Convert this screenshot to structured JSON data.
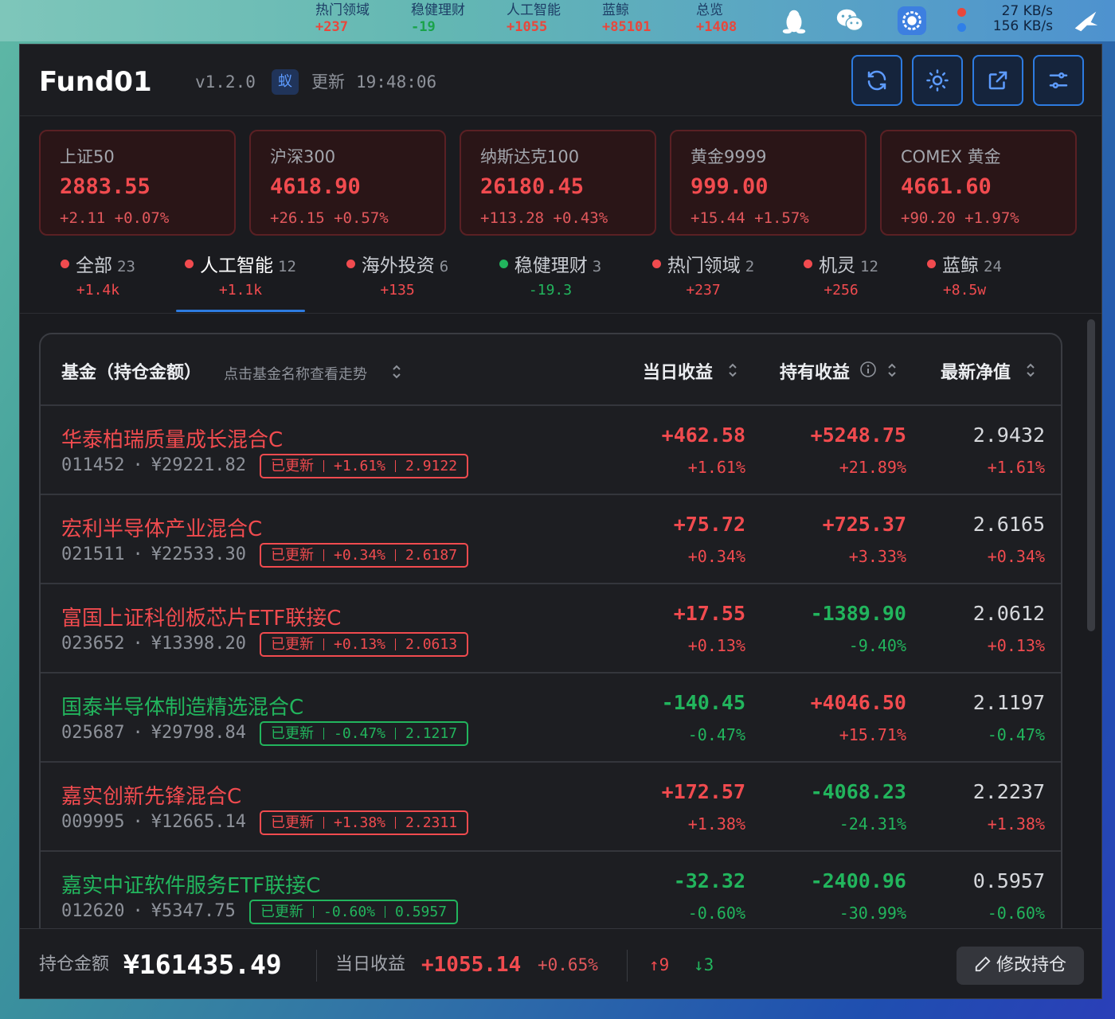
{
  "menubar": {
    "tickers": [
      {
        "name": "热门领域",
        "value": "+237",
        "dir": "up"
      },
      {
        "name": "稳健理财",
        "value": "-19",
        "dir": "down"
      },
      {
        "name": "人工智能",
        "value": "+1055",
        "dir": "up"
      },
      {
        "name": "蓝鲸",
        "value": "+85101",
        "dir": "up"
      },
      {
        "name": "总览",
        "value": "+1408",
        "dir": "up"
      }
    ],
    "net_up": "27 KB/s",
    "net_down": "156 KB/s"
  },
  "header": {
    "app_name": "Fund01",
    "version": "v1.2.0",
    "ant_badge": "蚁",
    "update_label": "更新",
    "update_time": "19:48:06"
  },
  "indices": [
    {
      "name": "上证50",
      "value": "2883.55",
      "change": "+2.11 +0.07%"
    },
    {
      "name": "沪深300",
      "value": "4618.90",
      "change": "+26.15 +0.57%"
    },
    {
      "name": "纳斯达克100",
      "value": "26180.45",
      "change": "+113.28 +0.43%"
    },
    {
      "name": "黄金9999",
      "value": "999.00",
      "change": "+15.44 +1.57%"
    },
    {
      "name": "COMEX 黄金",
      "value": "4661.60",
      "change": "+90.20 +1.97%"
    }
  ],
  "tabs": [
    {
      "label": "全部",
      "count": "23",
      "value": "+1.4k",
      "dir": "up"
    },
    {
      "label": "人工智能",
      "count": "12",
      "value": "+1.1k",
      "dir": "up",
      "active": true
    },
    {
      "label": "海外投资",
      "count": "6",
      "value": "+135",
      "dir": "up"
    },
    {
      "label": "稳健理财",
      "count": "3",
      "value": "-19.3",
      "dir": "down"
    },
    {
      "label": "热门领域",
      "count": "2",
      "value": "+237",
      "dir": "up"
    },
    {
      "label": "机灵",
      "count": "12",
      "value": "+256",
      "dir": "up"
    },
    {
      "label": "蓝鲸",
      "count": "24",
      "value": "+8.5w",
      "dir": "up"
    }
  ],
  "table": {
    "col_fund": "基金（持仓金额）",
    "col_hint": "点击基金名称查看走势",
    "col_daily": "当日收益",
    "col_hold": "持有收益",
    "col_nav": "最新净值",
    "rows": [
      {
        "name": "华泰柏瑞质量成长混合C",
        "code": "011452",
        "amount": "¥29221.82",
        "badge_status": "已更新",
        "badge_pct": "+1.61%",
        "badge_nav": "2.9122",
        "daily": "+462.58",
        "daily_pct": "+1.61%",
        "hold": "+5248.75",
        "hold_pct": "+21.89%",
        "nav": "2.9432",
        "nav_pct": "+1.61%",
        "dir": "up",
        "hold_dir": "up"
      },
      {
        "name": "宏利半导体产业混合C",
        "code": "021511",
        "amount": "¥22533.30",
        "badge_status": "已更新",
        "badge_pct": "+0.34%",
        "badge_nav": "2.6187",
        "daily": "+75.72",
        "daily_pct": "+0.34%",
        "hold": "+725.37",
        "hold_pct": "+3.33%",
        "nav": "2.6165",
        "nav_pct": "+0.34%",
        "dir": "up",
        "hold_dir": "up"
      },
      {
        "name": "富国上证科创板芯片ETF联接C",
        "code": "023652",
        "amount": "¥13398.20",
        "badge_status": "已更新",
        "badge_pct": "+0.13%",
        "badge_nav": "2.0613",
        "daily": "+17.55",
        "daily_pct": "+0.13%",
        "hold": "-1389.90",
        "hold_pct": "-9.40%",
        "nav": "2.0612",
        "nav_pct": "+0.13%",
        "dir": "up",
        "hold_dir": "down"
      },
      {
        "name": "国泰半导体制造精选混合C",
        "code": "025687",
        "amount": "¥29798.84",
        "badge_status": "已更新",
        "badge_pct": "-0.47%",
        "badge_nav": "2.1217",
        "daily": "-140.45",
        "daily_pct": "-0.47%",
        "hold": "+4046.50",
        "hold_pct": "+15.71%",
        "nav": "2.1197",
        "nav_pct": "-0.47%",
        "dir": "down",
        "hold_dir": "up"
      },
      {
        "name": "嘉实创新先锋混合C",
        "code": "009995",
        "amount": "¥12665.14",
        "badge_status": "已更新",
        "badge_pct": "+1.38%",
        "badge_nav": "2.2311",
        "daily": "+172.57",
        "daily_pct": "+1.38%",
        "hold": "-4068.23",
        "hold_pct": "-24.31%",
        "nav": "2.2237",
        "nav_pct": "+1.38%",
        "dir": "up",
        "hold_dir": "down"
      },
      {
        "name": "嘉实中证软件服务ETF联接C",
        "code": "012620",
        "amount": "¥5347.75",
        "badge_status": "已更新",
        "badge_pct": "-0.60%",
        "badge_nav": "0.5957",
        "daily": "-32.32",
        "daily_pct": "-0.60%",
        "hold": "-2400.96",
        "hold_pct": "-30.99%",
        "nav": "0.5957",
        "nav_pct": "-0.60%",
        "dir": "down",
        "hold_dir": "down"
      }
    ]
  },
  "footer": {
    "holding_label": "持仓金额",
    "holding_value": "¥161435.49",
    "daily_label": "当日收益",
    "daily_value": "+1055.14",
    "daily_pct": "+0.65%",
    "up_count": "↑9",
    "down_count": "↓3",
    "edit_label": "修改持仓"
  },
  "colors": {
    "up": "#f14b4f",
    "down": "#22b55d",
    "accent": "#2d7be0"
  }
}
